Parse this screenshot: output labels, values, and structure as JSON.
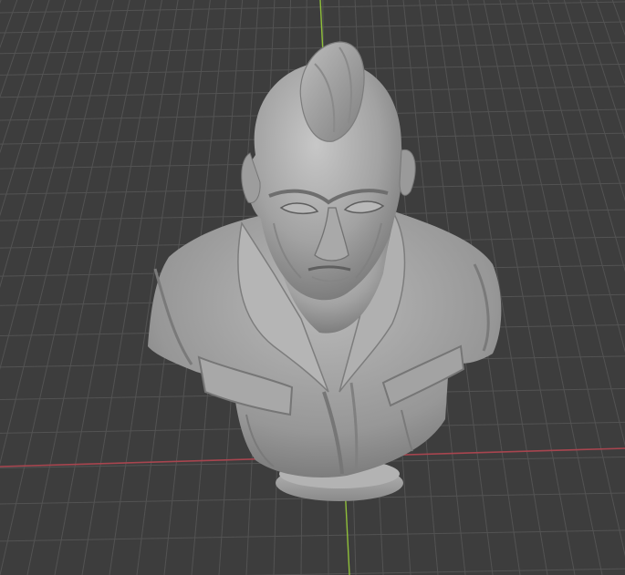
{
  "viewport": {
    "background": "#3d3d3d",
    "grid_color": "#535353",
    "x_axis_color": "#a8454f",
    "y_axis_color": "#8fbf3a"
  },
  "model": {
    "type": "sculpted-bust",
    "material_color": "#9a9a9a",
    "shading": "solid-matcap-gray"
  }
}
